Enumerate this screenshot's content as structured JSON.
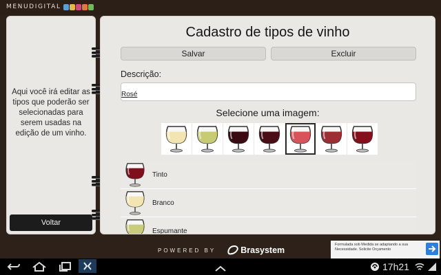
{
  "header": {
    "logo_text": "MENUDIGITAL"
  },
  "left_panel": {
    "help_text": "Aqui você irá editar as tipos que poderão ser selecionadas para serem usadas na edição de um vinho.",
    "back_label": "Voltar"
  },
  "form": {
    "title": "Cadastro de tipos de vinho",
    "save_label": "Salvar",
    "delete_label": "Excluir",
    "description_label": "Descrição:",
    "description_value": "Rosé",
    "image_label": "Selecione uma imagem:",
    "selected_image_index": 4,
    "images": [
      {
        "name": "white-wine-glass-icon",
        "color": "#f3e5b2"
      },
      {
        "name": "green-white-wine-glass-icon",
        "color": "#c7cc74"
      },
      {
        "name": "dark-red-wine-glass-icon",
        "color": "#3a0b12"
      },
      {
        "name": "dark-red-wine-glass-icon",
        "color": "#4a0f16"
      },
      {
        "name": "rose-wine-glass-icon",
        "color": "#d9545a"
      },
      {
        "name": "red-wine-glass-icon",
        "color": "#9d2e33"
      },
      {
        "name": "red-wine-glass-icon",
        "color": "#860f1c"
      }
    ]
  },
  "types": [
    {
      "label": "Tinto",
      "icon": "red-wine-glass-icon",
      "color": "#7f0f1c"
    },
    {
      "label": "Branco",
      "icon": "white-wine-glass-icon",
      "color": "#f3e5b2"
    },
    {
      "label": "Espumante",
      "icon": "sparkling-wine-glass-icon",
      "color": "#c9cc7a"
    }
  ],
  "footer": {
    "powered_text": "POWERED BY",
    "brand": "Brasystem",
    "ad_text": "Formulada sob Medida se adaptando a sua Necessidade. Solicite Orçamento"
  },
  "status_bar": {
    "time": "17h21"
  },
  "colors": {
    "background": "#2e2119",
    "panel": "#eae8e4",
    "ad_accent": "#2d7fd7"
  }
}
